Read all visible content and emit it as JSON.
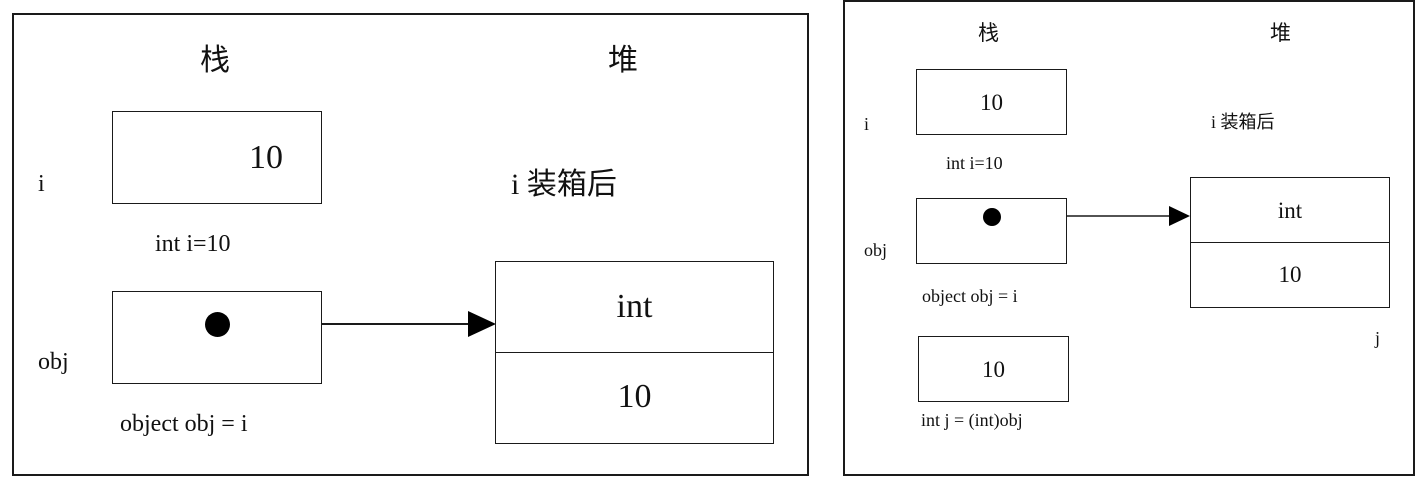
{
  "left_diagram": {
    "stack_header": "栈",
    "heap_header": "堆",
    "var_i": "i",
    "var_obj": "obj",
    "i_value": "10",
    "i_caption": "int i=10",
    "boxing_note": "i 装箱后",
    "obj_caption": "object obj = i",
    "heap_type": "int",
    "heap_value": "10"
  },
  "right_diagram": {
    "stack_header": "栈",
    "heap_header": "堆",
    "var_i": "i",
    "var_obj": "obj",
    "var_j": "j",
    "i_value": "10",
    "i_caption": "int i=10",
    "boxing_note": "i 装箱后",
    "obj_caption": "object obj = i",
    "heap_type": "int",
    "heap_value": "10",
    "j_value": "10",
    "j_caption": "int j = (int)obj"
  },
  "colors": {
    "stroke": "#1a1a1a",
    "background": "#ffffff"
  }
}
